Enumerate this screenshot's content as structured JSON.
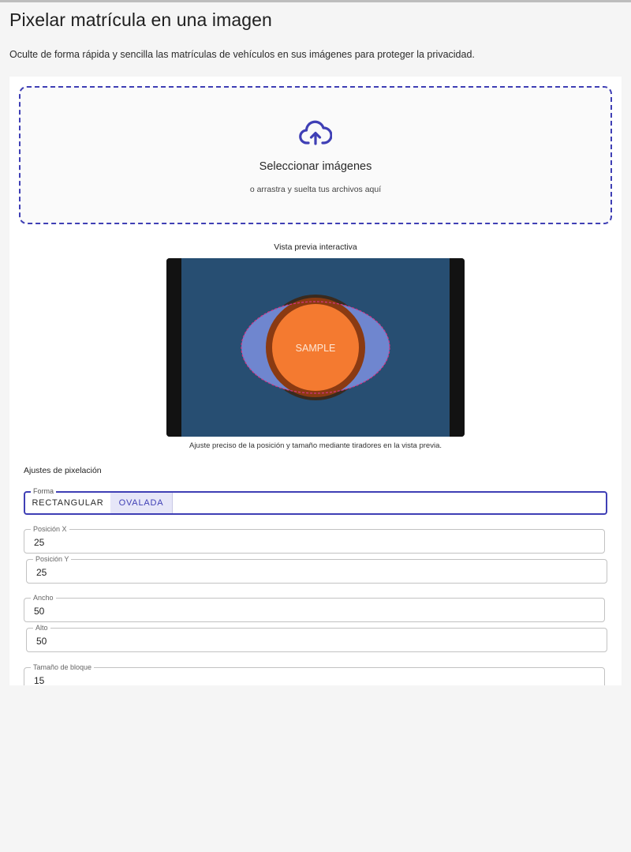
{
  "page": {
    "title": "Pixelar matrícula en una imagen",
    "subtitle": "Oculte de forma rápida y sencilla las matrículas de vehículos en sus imágenes para proteger la privacidad."
  },
  "upload": {
    "title": "Seleccionar imágenes",
    "hint": "o arrastra y suelta tus archivos aquí",
    "icon": "cloud-upload-icon"
  },
  "preview": {
    "label": "Vista previa interactiva",
    "sample_text": "SAMPLE",
    "caption": "Ajuste preciso de la posición y tamaño mediante tiradores en la vista previa."
  },
  "settings": {
    "title": "Ajustes de pixelación",
    "shape": {
      "label": "Forma",
      "options": [
        "RECTANGULAR",
        "OVALADA"
      ],
      "selected": "OVALADA"
    },
    "pos_x": {
      "label": "Posición X",
      "value": "25"
    },
    "pos_y": {
      "label": "Posición Y",
      "value": "25"
    },
    "width": {
      "label": "Ancho",
      "value": "50"
    },
    "height": {
      "label": "Alto",
      "value": "50"
    },
    "block_size": {
      "label": "Tamaño de bloque",
      "value": "15"
    }
  },
  "colors": {
    "accent": "#3f3fb5",
    "preview_bg": "#274e72",
    "sample_orange": "#f47a30",
    "overlay_blue": "#6f86cf",
    "outline_magenta": "#d63384"
  }
}
